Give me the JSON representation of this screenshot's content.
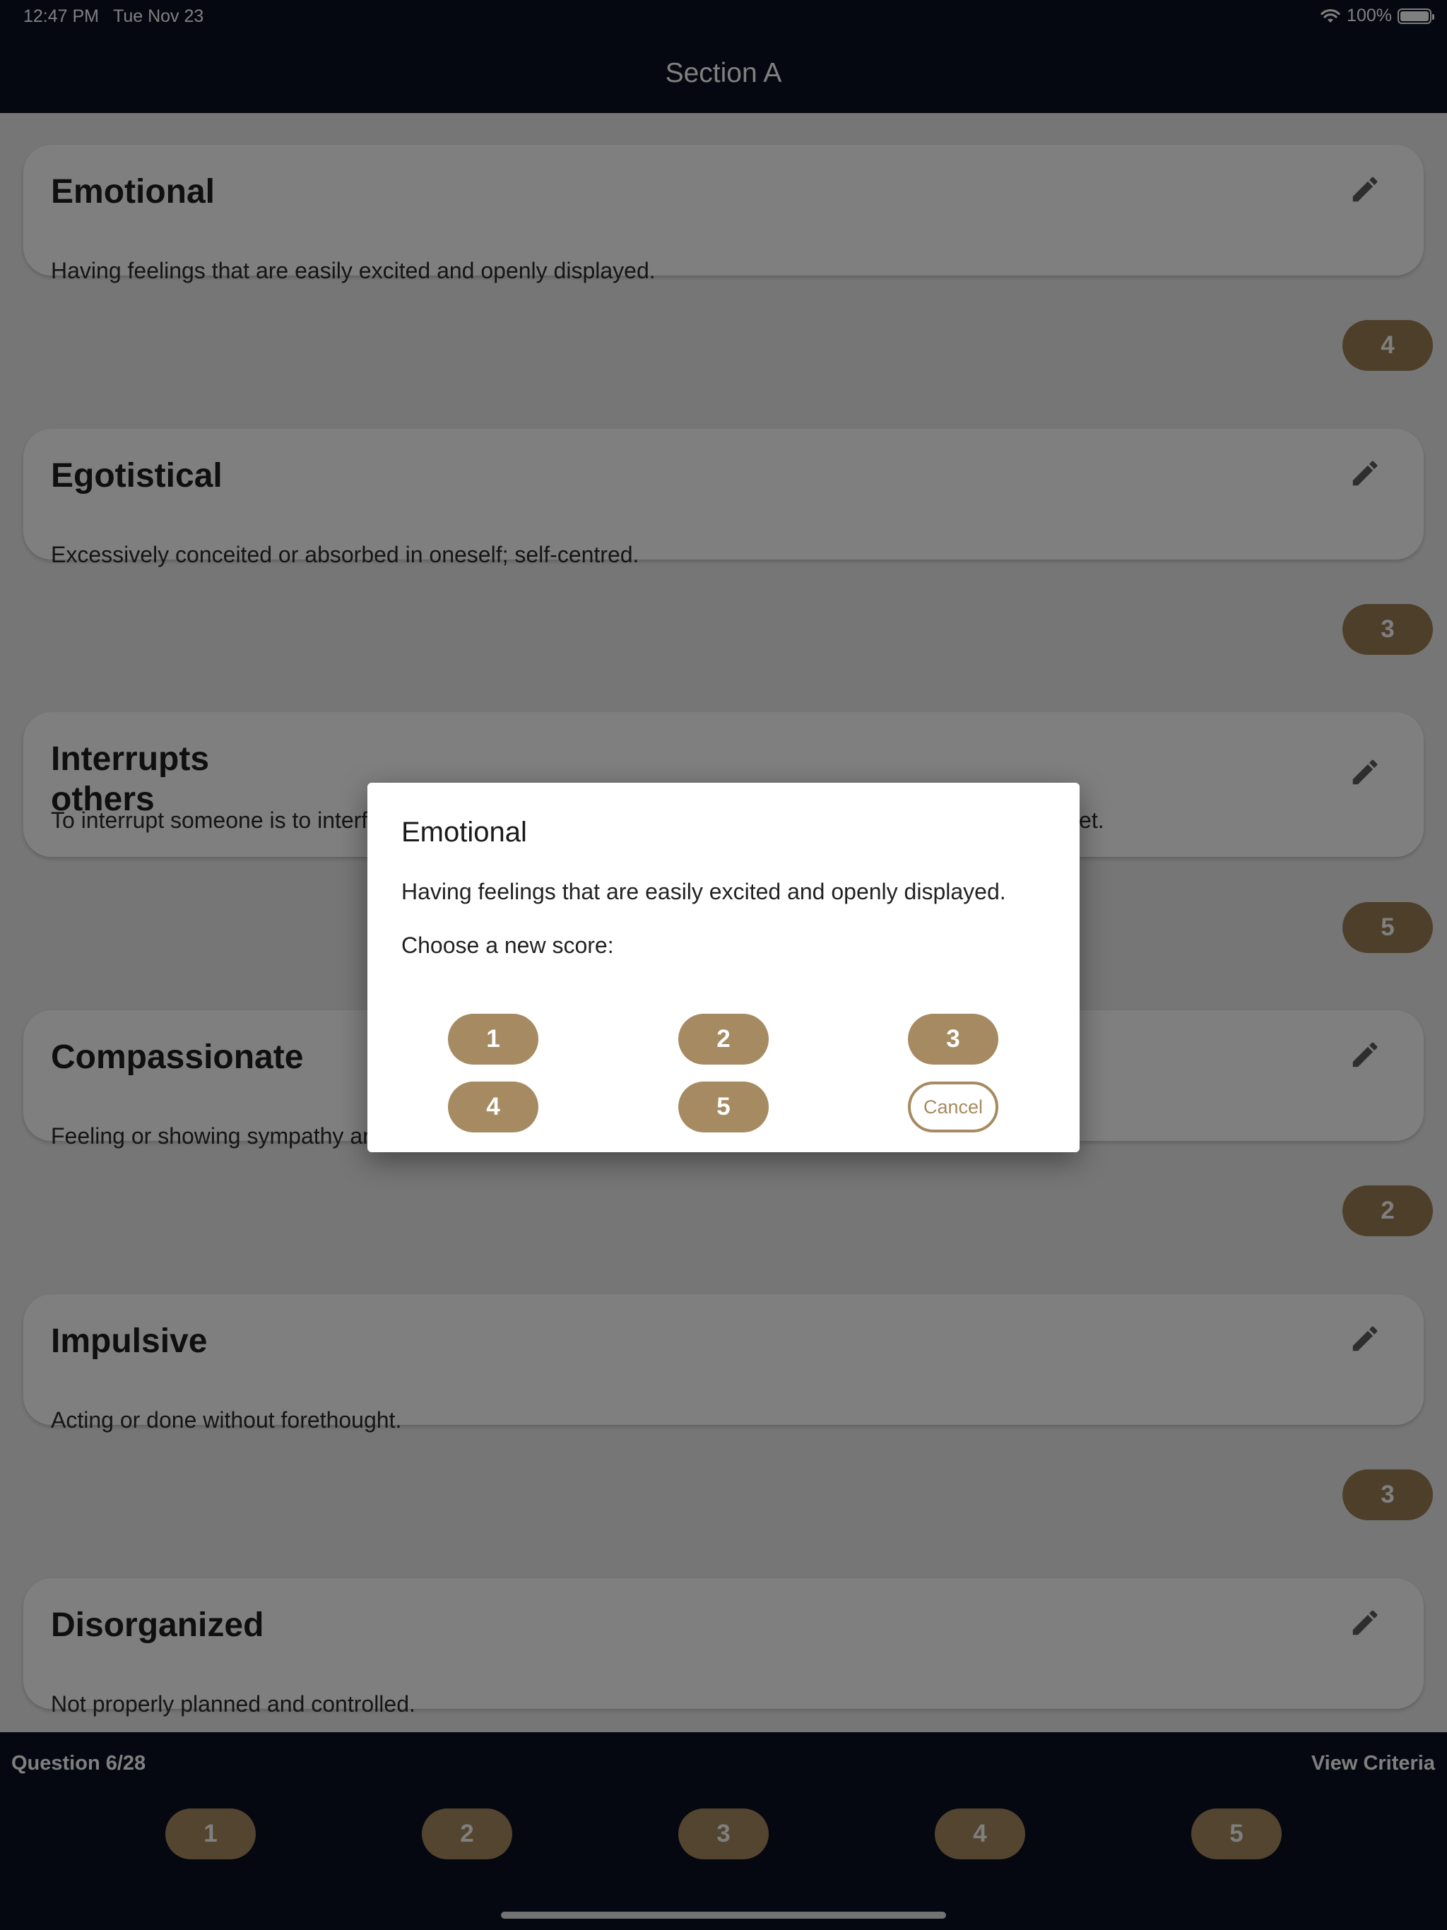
{
  "status_bar": {
    "time": "12:47 PM",
    "date": "Tue Nov 23",
    "battery": "100%"
  },
  "header": {
    "title": "Section A"
  },
  "items": [
    {
      "title": "Emotional",
      "description": "Having feelings that are easily excited and openly displayed.",
      "score": "4"
    },
    {
      "title": "Egotistical",
      "description": "Excessively conceited or absorbed in oneself; self-centred.",
      "score": "3"
    },
    {
      "title": "Interrupts\nothers",
      "description": "To interrupt someone is to interfere with what they are saying or doing, or to disturb their peace and quiet.",
      "score": "5"
    },
    {
      "title": "Compassionate",
      "description": "Feeling or showing sympathy and concern for others.",
      "score": "2"
    },
    {
      "title": "Impulsive",
      "description": "Acting or done without forethought.",
      "score": "3"
    },
    {
      "title": "Disorganized",
      "description": "Not properly planned and controlled.",
      "score": ""
    }
  ],
  "footer": {
    "question": "Question 6/28",
    "view_criteria": "View Criteria",
    "scores": [
      "1",
      "2",
      "3",
      "4",
      "5"
    ]
  },
  "dialog": {
    "title": "Emotional",
    "description": "Having feelings that are easily excited and openly displayed.",
    "prompt": "Choose a new score:",
    "options": [
      "1",
      "2",
      "3",
      "4",
      "5"
    ],
    "cancel_label": "Cancel"
  },
  "colors": {
    "nav_bg": "#0b1120",
    "accent": "#a68a61",
    "page_bg": "#ededed"
  },
  "icons": {
    "edit": "pencil-icon",
    "wifi": "wifi-icon",
    "battery": "battery-icon"
  }
}
